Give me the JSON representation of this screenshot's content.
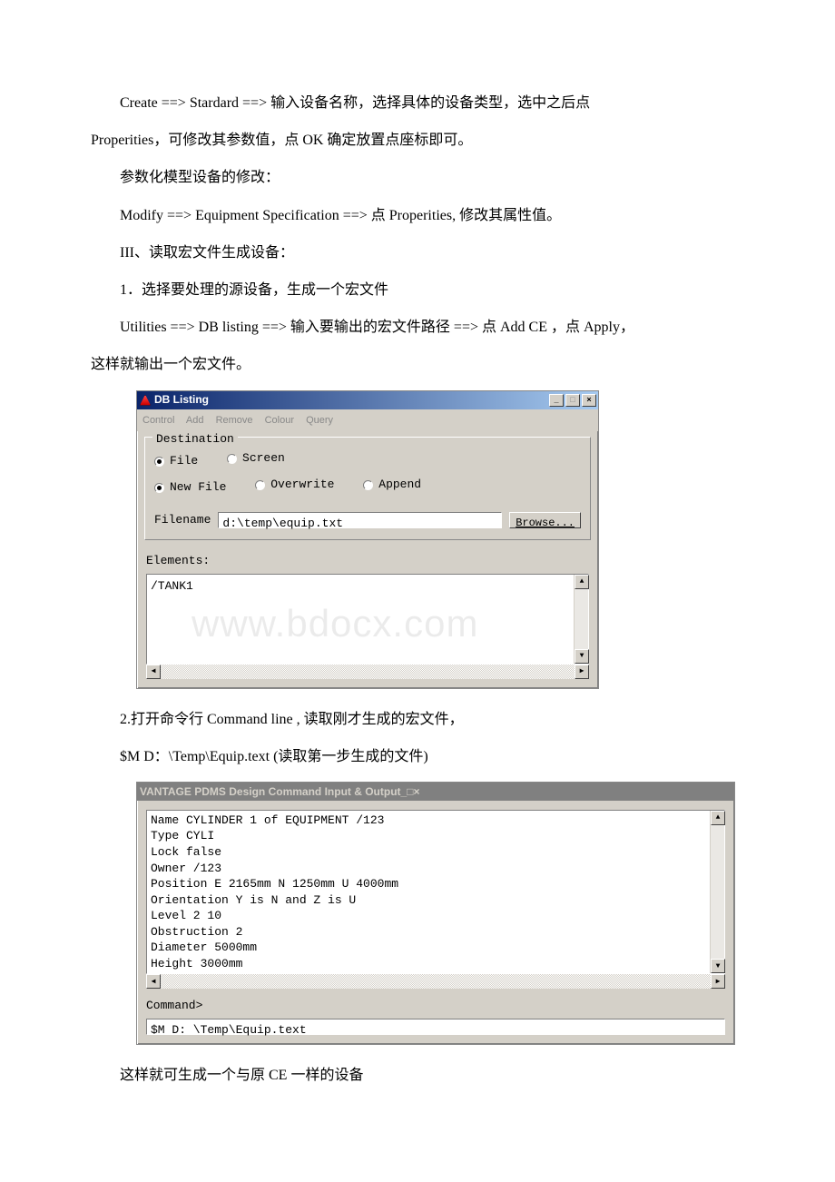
{
  "page": {
    "p1a": "Create ==> Stardard ==> 输入设备名称，选择具体的设备类型，选中之后点",
    "p1b": "Properities，可修改其参数值，点 OK 确定放置点座标即可。",
    "p2": "参数化模型设备的修改：",
    "p3": "Modify ==> Equipment Specification ==> 点 Properities, 修改其属性值。",
    "p4": "III、读取宏文件生成设备：",
    "p5": "1．选择要处理的源设备，生成一个宏文件",
    "p6a": "Utilities ==> DB listing ==> 输入要输出的宏文件路径 ==> 点 Add CE ，点 Apply，",
    "p6b": "这样就输出一个宏文件。",
    "p7": "2.打开命令行 Command line , 读取刚才生成的宏文件，",
    "p8": "$M D：\\Temp\\Equip.text (读取第一步生成的文件)",
    "p9": "这样就可生成一个与原 CE 一样的设备"
  },
  "dialog1": {
    "title": "DB Listing",
    "menu": [
      "Control",
      "Add",
      "Remove",
      "Colour",
      "Query"
    ],
    "groupTitle": "Destination",
    "radios1": [
      {
        "label": "File",
        "selected": true
      },
      {
        "label": "Screen",
        "selected": false
      }
    ],
    "radios2": [
      {
        "label": "New File",
        "selected": true
      },
      {
        "label": "Overwrite",
        "selected": false
      },
      {
        "label": "Append",
        "selected": false
      }
    ],
    "filenameLabel": "Filename",
    "filenameValue": "d:\\temp\\equip.txt",
    "browseLabel": "Browse...",
    "elementsLabel": "Elements:",
    "listItem": "/TANK1",
    "watermark": "www.bdocx.com"
  },
  "dialog2": {
    "title": "VANTAGE PDMS Design Command Input & Output",
    "outputLines": [
      "Name CYLINDER 1 of EQUIPMENT /123",
      "Type CYLI",
      "Lock false",
      "Owner /123",
      "Position E 2165mm N 1250mm U 4000mm",
      "Orientation Y is N and Z is U",
      "Level 2 10",
      "Obstruction 2",
      "Diameter 5000mm",
      "Height 3000mm"
    ],
    "commandLabel": "Command>",
    "commandValue": "$M  D: \\Temp\\Equip.text"
  },
  "winbtns": {
    "min": "_",
    "max": "□",
    "close": "×"
  },
  "arrows": {
    "up": "▲",
    "down": "▼",
    "left": "◀",
    "right": "▶"
  }
}
